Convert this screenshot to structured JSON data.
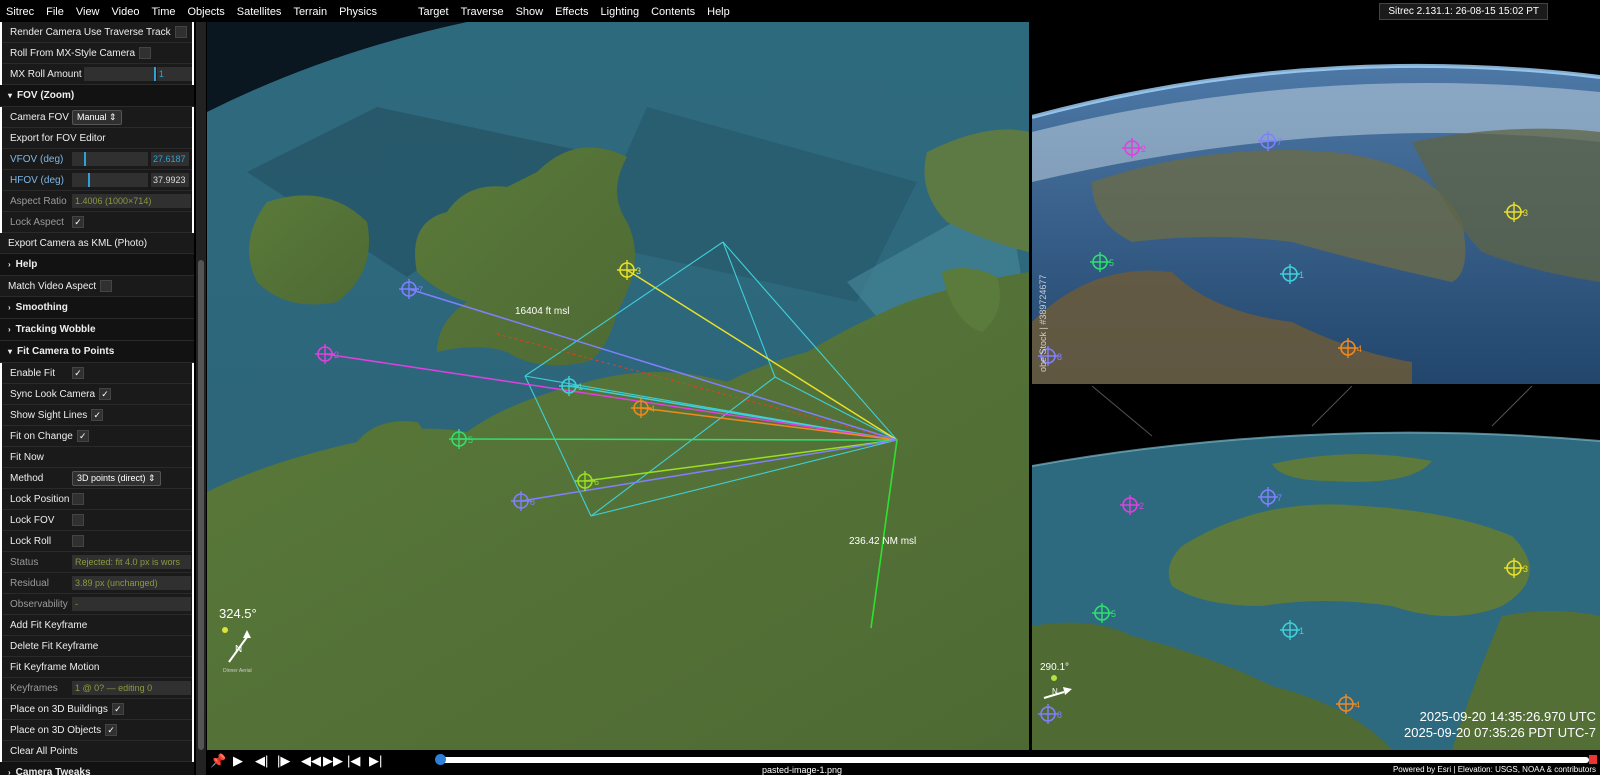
{
  "menus": {
    "left": [
      "Sitrec",
      "File",
      "View",
      "Video",
      "Time",
      "Objects",
      "Satellites",
      "Terrain",
      "Physics"
    ],
    "right": [
      "Target",
      "Traverse",
      "Show",
      "Effects",
      "Lighting",
      "Contents",
      "Help"
    ],
    "version": "Sitrec 2.131.1: 26-08-15 15:02 PT"
  },
  "panel": {
    "render_traverse": "Render Camera Use Traverse Track",
    "roll_mx": "Roll From MX-Style Camera",
    "mx_roll_label": "MX Roll Amount",
    "mx_roll_value": "1",
    "fov_folder": "FOV (Zoom)",
    "camera_fov_label": "Camera FOV",
    "camera_fov_value": "Manual",
    "export_fov": "Export for FOV Editor",
    "vfov_label": "VFOV (deg)",
    "vfov_value": "27.6187",
    "hfov_label": "HFOV (deg)",
    "hfov_value": "37.9923",
    "aspect_label": "Aspect Ratio",
    "aspect_value": "1.4006  (1000×714)",
    "lock_aspect": "Lock Aspect",
    "export_kml": "Export Camera as KML (Photo)",
    "help_folder": "Help",
    "match_video": "Match Video Aspect",
    "smoothing_folder": "Smoothing",
    "wobble_folder": "Tracking Wobble",
    "fit_folder": "Fit Camera to Points",
    "enable_fit": "Enable Fit",
    "sync_look": "Sync Look Camera",
    "show_sight": "Show Sight Lines",
    "fit_change": "Fit on Change",
    "fit_now": "Fit Now",
    "method_label": "Method",
    "method_value": "3D points (direct)",
    "lock_position": "Lock Position",
    "lock_fov": "Lock FOV",
    "lock_roll": "Lock Roll",
    "status_label": "Status",
    "status_value": "Rejected: fit 4.0 px is wors",
    "residual_label": "Residual",
    "residual_value": "3.89 px (unchanged)",
    "obs_label": "Observability",
    "obs_value": "-",
    "add_key": "Add Fit Keyframe",
    "del_key": "Delete Fit Keyframe",
    "key_motion": "Fit Keyframe Motion",
    "keyframes_label": "Keyframes",
    "keyframes_value": "1 @ 0? — editing 0",
    "place_buildings": "Place on 3D Buildings",
    "place_objects": "Place on 3D Objects",
    "clear_points": "Clear All Points",
    "tweaks_folder": "Camera Tweaks"
  },
  "main_view": {
    "label_altitude": "16404 ft msl",
    "label_distance": "236.42 NM msl",
    "heading": "324.5°",
    "compass_n": "N",
    "compass_sub": "Dinner Aerial"
  },
  "bottom_view": {
    "heading": "290.1°",
    "compass_n": "N",
    "utc": "2025-09-20 14:35:26.970 UTC",
    "pdt": "2025-09-20 07:35:26 PDT UTC-7"
  },
  "photo_view": {
    "watermark": "obe Stock | #389724677"
  },
  "points": [
    {
      "id": "1",
      "color": "#3fd0d8"
    },
    {
      "id": "2",
      "color": "#e040e0"
    },
    {
      "id": "3",
      "color": "#e8e02a"
    },
    {
      "id": "4",
      "color": "#f08a20"
    },
    {
      "id": "5",
      "color": "#30e070"
    },
    {
      "id": "6",
      "color": "#9ae020"
    },
    {
      "id": "7",
      "color": "#8080ff"
    },
    {
      "id": "8",
      "color": "#8080ff"
    }
  ],
  "footer": {
    "filename": "pasted-image-1.png",
    "credits": "Powered by Esri | Elevation: USGS, NOAA & contributors"
  }
}
